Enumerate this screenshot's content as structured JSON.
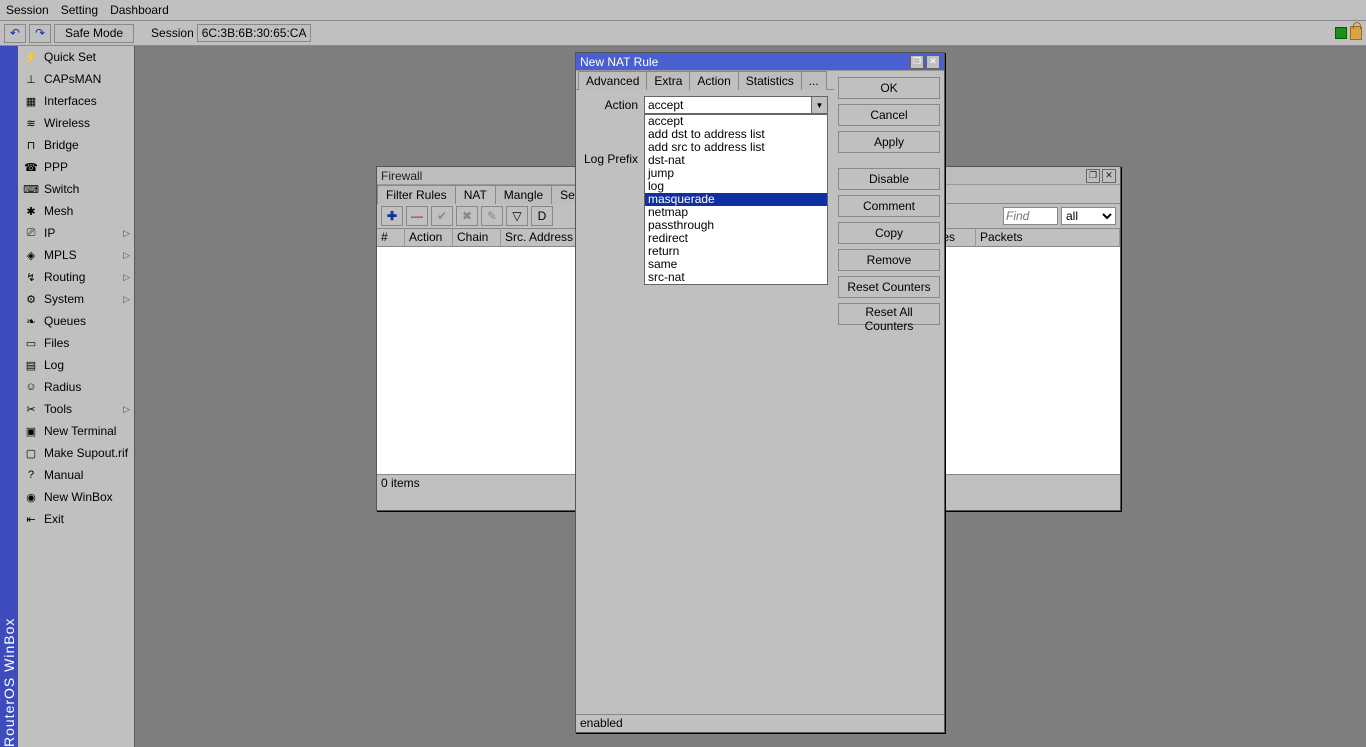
{
  "menubar": {
    "items": [
      "Session",
      "Setting",
      "Dashboard"
    ]
  },
  "toolbar": {
    "undo_glyph": "↶",
    "redo_glyph": "↷",
    "safe_mode": "Safe Mode",
    "session_label": "Session",
    "session_id": "6C:3B:6B:30:65:CA"
  },
  "vertical_label": "RouterOS WinBox",
  "sidebar": {
    "items": [
      {
        "icon": "⚡",
        "label": "Quick Set",
        "sub": false
      },
      {
        "icon": "⊥",
        "label": "CAPsMAN",
        "sub": false
      },
      {
        "icon": "▦",
        "label": "Interfaces",
        "sub": false
      },
      {
        "icon": "≋",
        "label": "Wireless",
        "sub": false
      },
      {
        "icon": "⊓",
        "label": "Bridge",
        "sub": false
      },
      {
        "icon": "☎",
        "label": "PPP",
        "sub": false
      },
      {
        "icon": "⌨",
        "label": "Switch",
        "sub": false
      },
      {
        "icon": "✱",
        "label": "Mesh",
        "sub": false
      },
      {
        "icon": "⎚",
        "label": "IP",
        "sub": true
      },
      {
        "icon": "◈",
        "label": "MPLS",
        "sub": true
      },
      {
        "icon": "↯",
        "label": "Routing",
        "sub": true
      },
      {
        "icon": "⚙",
        "label": "System",
        "sub": true
      },
      {
        "icon": "❧",
        "label": "Queues",
        "sub": false
      },
      {
        "icon": "▭",
        "label": "Files",
        "sub": false
      },
      {
        "icon": "▤",
        "label": "Log",
        "sub": false
      },
      {
        "icon": "☺",
        "label": "Radius",
        "sub": false
      },
      {
        "icon": "✂",
        "label": "Tools",
        "sub": true
      },
      {
        "icon": "▣",
        "label": "New Terminal",
        "sub": false
      },
      {
        "icon": "▢",
        "label": "Make Supout.rif",
        "sub": false
      },
      {
        "icon": "?",
        "label": "Manual",
        "sub": false
      },
      {
        "icon": "◉",
        "label": "New WinBox",
        "sub": false
      },
      {
        "icon": "⇤",
        "label": "Exit",
        "sub": false
      }
    ]
  },
  "firewall_window": {
    "title": "Firewall",
    "tabs": [
      "Filter Rules",
      "NAT",
      "Mangle",
      "Service Ports"
    ],
    "active_tab": "NAT",
    "toolbar_icons": {
      "add": "✚",
      "remove": "—",
      "enable": "✔",
      "disable": "✖",
      "comment": "✎",
      "filter": "▽",
      "default": "D"
    },
    "find_placeholder": "Find",
    "filter_value": "all",
    "columns": [
      "#",
      "Action",
      "Chain",
      "Src. Address",
      "Bytes",
      "Packets"
    ],
    "status": "0 items"
  },
  "nat_window": {
    "title": "New NAT Rule",
    "tabs": [
      "Advanced",
      "Extra",
      "Action",
      "Statistics",
      "..."
    ],
    "active_tab": "Action",
    "fields": {
      "action_label": "Action",
      "action_value": "accept",
      "log_prefix_label": "Log Prefix"
    },
    "dropdown_options": [
      "accept",
      "add dst to address list",
      "add src to address list",
      "dst-nat",
      "jump",
      "log",
      "masquerade",
      "netmap",
      "passthrough",
      "redirect",
      "return",
      "same",
      "src-nat"
    ],
    "dropdown_selected": "masquerade",
    "buttons": [
      "OK",
      "Cancel",
      "Apply",
      "Disable",
      "Comment",
      "Copy",
      "Remove",
      "Reset Counters",
      "Reset All Counters"
    ],
    "status": "enabled"
  }
}
